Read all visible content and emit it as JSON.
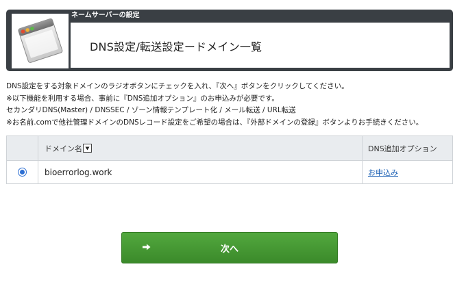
{
  "header": {
    "section_label": "ネームサーバーの設定",
    "title": "DNS設定/転送設定ードメイン一覧",
    "icon": "application-window-icon"
  },
  "description": {
    "lines": [
      "DNS設定をする対象ドメインのラジオボタンにチェックを入れ、『次へ』ボタンをクリックしてください。",
      "※以下機能を利用する場合、事前に『DNS追加オプション』のお申込みが必要です。",
      "セカンダリDNS(Master) / DNSSEC / ゾーン情報テンプレート化 / メール転送 / URL転送",
      "※お名前.comで他社管理ドメインのDNSレコード設定をご希望の場合は、『外部ドメインの登録』ボタンよりお手続きください。"
    ]
  },
  "table": {
    "headers": {
      "domain": "ドメイン名",
      "option": "DNS追加オプション"
    },
    "sort_icon": "sort-down-icon",
    "rows": [
      {
        "domain": "bioerrorlog.work",
        "option_link": "お申込み",
        "selected": true
      }
    ]
  },
  "next_button": {
    "label": "次へ",
    "icon": "arrow-right-icon"
  },
  "colors": {
    "header_bg": "#3a3f44",
    "button_green": "#3b8a2a",
    "link_blue": "#1a5fb4",
    "radio_blue": "#2d6fd3",
    "table_header_bg": "#e9ecef"
  }
}
